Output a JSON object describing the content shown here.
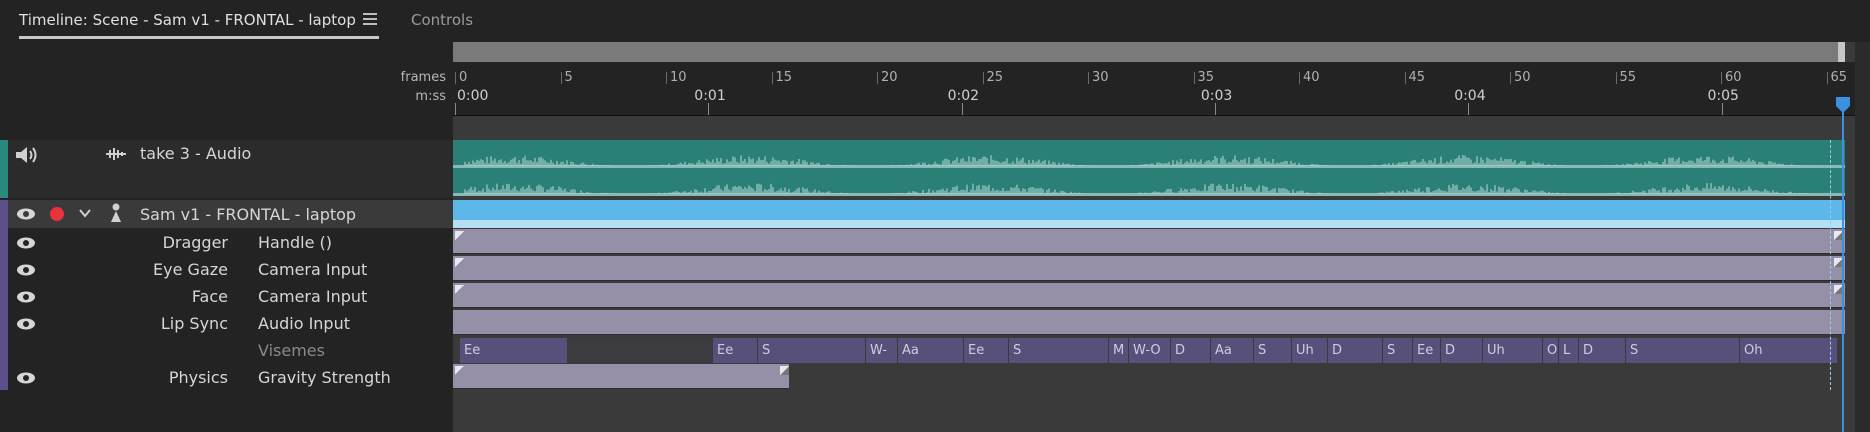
{
  "tabs": {
    "active": "Timeline: Scene - Sam v1 - FRONTAL - laptop",
    "other": "Controls"
  },
  "ruler": {
    "frames_label": "frames",
    "time_label": "m:ss",
    "frame_numbers": [
      "0",
      "5",
      "10",
      "15",
      "20",
      "25",
      "30",
      "35",
      "40",
      "45",
      "50",
      "55",
      "60",
      "65"
    ],
    "time_marks": [
      "0:00",
      "0:01",
      "0:02",
      "0:03",
      "0:04",
      "0:05"
    ]
  },
  "tracks": {
    "audio": {
      "name": "take 3 - Audio",
      "icon": "speaker-icon",
      "color": "#2a7f76"
    },
    "puppet": {
      "name": "Sam v1 - FRONTAL - laptop",
      "color": "#5db7e8",
      "record_color": "#e8323c"
    },
    "params": [
      {
        "behavior": "Dragger",
        "input": "Handle ()"
      },
      {
        "behavior": "Eye Gaze",
        "input": "Camera Input"
      },
      {
        "behavior": "Face",
        "input": "Camera Input"
      },
      {
        "behavior": "Lip Sync",
        "input": "Audio Input"
      },
      {
        "behavior": "",
        "input": "Visemes"
      },
      {
        "behavior": "Physics",
        "input": "Gravity Strength"
      }
    ]
  },
  "visemes": [
    "Ee",
    "Ee",
    "S",
    "W-",
    "Aa",
    "Ee",
    "S",
    "M",
    "W-O",
    "D",
    "Aa",
    "S",
    "Uh",
    "D",
    "S",
    "Ee",
    "D",
    "Uh",
    "O",
    "L",
    "D",
    "S",
    "Oh"
  ],
  "colors": {
    "param_bar": "#958fa8",
    "viseme_bar": "#57507a",
    "playhead": "#3d8fe0"
  }
}
